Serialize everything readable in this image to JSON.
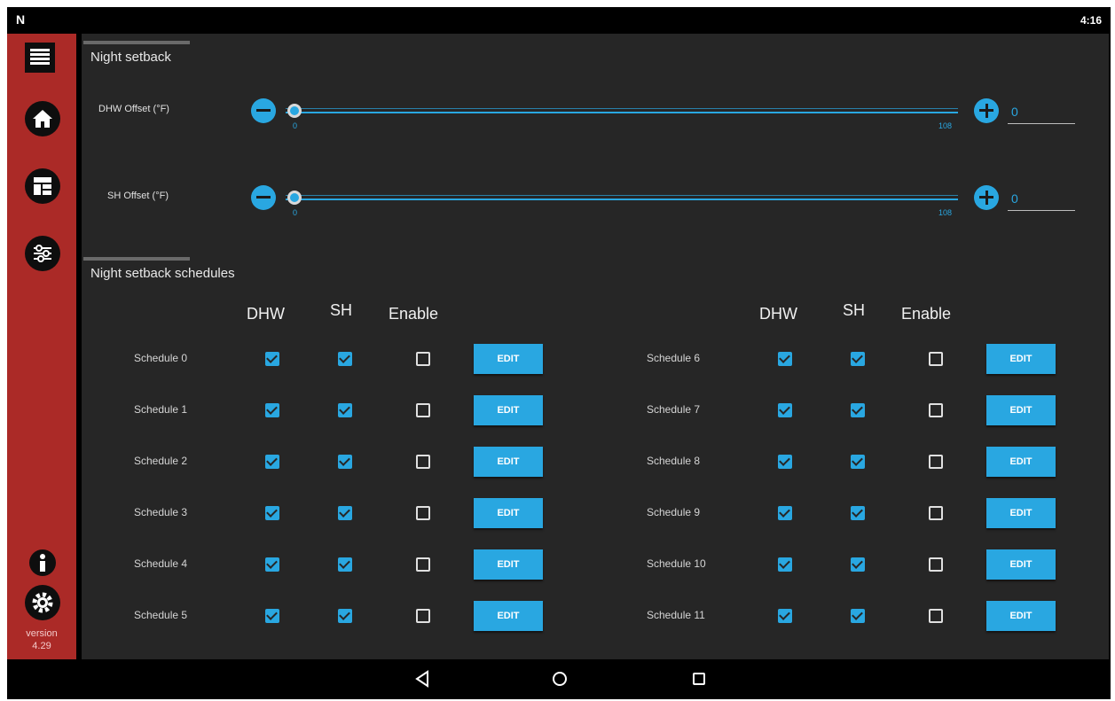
{
  "statusbar": {
    "logo": "N",
    "clock": "4:16"
  },
  "sidebar": {
    "menu_icon": "hamburger-menu-icon",
    "items": [
      {
        "name": "home-icon"
      },
      {
        "name": "dashboard-icon"
      },
      {
        "name": "sliders-icon"
      }
    ],
    "info_icon": "info-icon",
    "settings_icon": "gear-icon",
    "version_label": "version",
    "version_number": "4.29"
  },
  "night_setback": {
    "title": "Night setback",
    "sliders": [
      {
        "label": "DHW Offset (°F)",
        "min": "0",
        "max": "108",
        "value": "0",
        "level": 0
      },
      {
        "label": "SH Offset (°F)",
        "min": "0",
        "max": "108",
        "value": "0",
        "level": 0
      }
    ]
  },
  "schedules": {
    "title": "Night setback schedules",
    "headers": {
      "dhw": "DHW",
      "sh": "SH",
      "enable": "Enable"
    },
    "edit_label": "EDIT",
    "rows": [
      {
        "label": "Schedule 0",
        "dhw": true,
        "sh": true,
        "enable": false
      },
      {
        "label": "Schedule 1",
        "dhw": true,
        "sh": true,
        "enable": false
      },
      {
        "label": "Schedule 2",
        "dhw": true,
        "sh": true,
        "enable": false
      },
      {
        "label": "Schedule 3",
        "dhw": true,
        "sh": true,
        "enable": false
      },
      {
        "label": "Schedule 4",
        "dhw": true,
        "sh": true,
        "enable": false
      },
      {
        "label": "Schedule 5",
        "dhw": true,
        "sh": true,
        "enable": false
      },
      {
        "label": "Schedule 6",
        "dhw": true,
        "sh": true,
        "enable": false
      },
      {
        "label": "Schedule 7",
        "dhw": true,
        "sh": true,
        "enable": false
      },
      {
        "label": "Schedule 8",
        "dhw": true,
        "sh": true,
        "enable": false
      },
      {
        "label": "Schedule 9",
        "dhw": true,
        "sh": true,
        "enable": false
      },
      {
        "label": "Schedule 10",
        "dhw": true,
        "sh": true,
        "enable": false
      },
      {
        "label": "Schedule 11",
        "dhw": true,
        "sh": true,
        "enable": false
      }
    ]
  },
  "navbar": {
    "back": "back-icon",
    "home": "home-circle-icon",
    "recents": "recents-icon"
  },
  "colors": {
    "accent": "#29a7e1",
    "sidebar": "#ab2a27",
    "background": "#262626"
  }
}
